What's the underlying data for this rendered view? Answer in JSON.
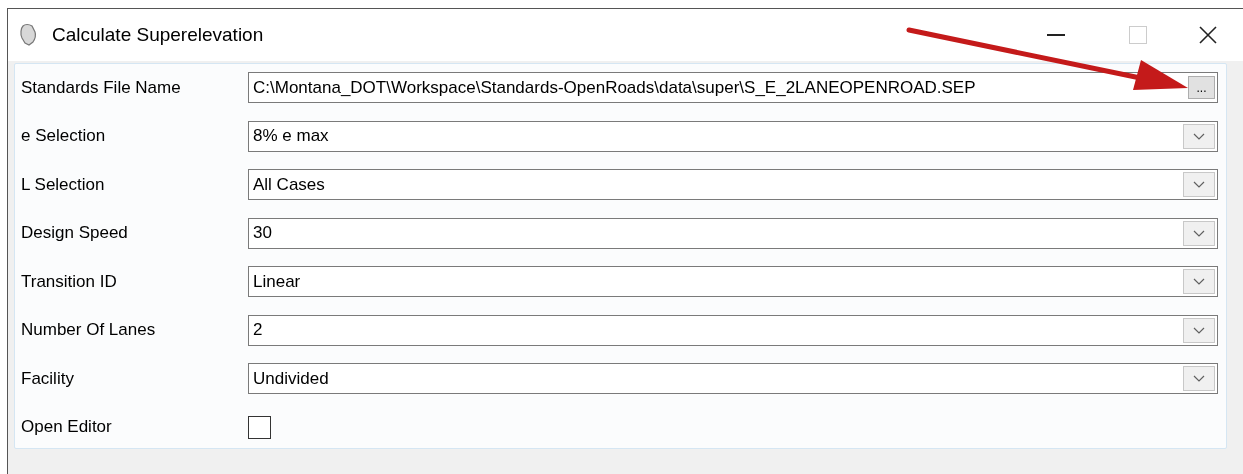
{
  "window": {
    "title": "Calculate Superelevation",
    "maximize_disabled": true
  },
  "fields": [
    {
      "kind": "browse",
      "label": "Standards File Name",
      "value": "C:\\Montana_DOT\\Workspace\\Standards-OpenRoads\\data\\super\\S_E_2LANEOPENROAD.SEP",
      "button": "..."
    },
    {
      "kind": "dropdown",
      "label": "e Selection",
      "value": "8% e max"
    },
    {
      "kind": "dropdown",
      "label": "L Selection",
      "value": "All Cases"
    },
    {
      "kind": "dropdown",
      "label": "Design Speed",
      "value": "30"
    },
    {
      "kind": "dropdown",
      "label": "Transition ID",
      "value": "Linear"
    },
    {
      "kind": "dropdown",
      "label": "Number Of Lanes",
      "value": "2"
    },
    {
      "kind": "dropdown",
      "label": "Facility",
      "value": "Undivided"
    },
    {
      "kind": "checkbox",
      "label": "Open Editor",
      "checked": false
    }
  ]
}
